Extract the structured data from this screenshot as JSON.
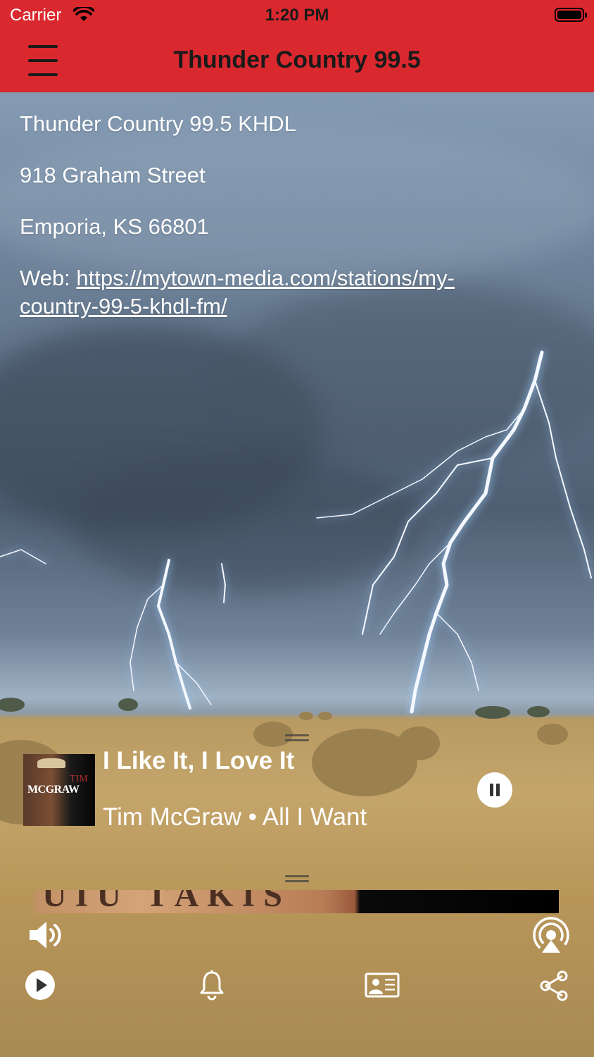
{
  "status_bar": {
    "carrier": "Carrier",
    "time": "1:20 PM"
  },
  "nav": {
    "title": "Thunder Country 99.5",
    "menu_icon": "hamburger-menu-icon"
  },
  "station": {
    "name": "Thunder Country 99.5 KHDL",
    "street": "918 Graham Street",
    "city": "Emporia, KS 66801",
    "web_label": "Web:",
    "web_url_line1": "https://mytown-media.com/stations/my-",
    "web_url_line2": "country-99-5-khdl-fm/"
  },
  "now_playing": {
    "title": "I Like It, I Love It",
    "subtitle": "Tim McGraw • All I Want",
    "album_art_text": "MCGRAW",
    "album_art_text2": "TIM",
    "state": "playing",
    "pause_icon": "pause-icon"
  },
  "strip_text": "UIU TAKIS",
  "controls": {
    "volume_icon": "speaker-volume-icon",
    "airplay_icon": "airplay-icon",
    "play_icon": "play-circle-icon",
    "alarm_icon": "bell-icon",
    "contact_icon": "contact-card-icon",
    "share_icon": "share-icon"
  },
  "colors": {
    "brand_red": "#d9282e",
    "nav_text": "#1a1a1a"
  }
}
